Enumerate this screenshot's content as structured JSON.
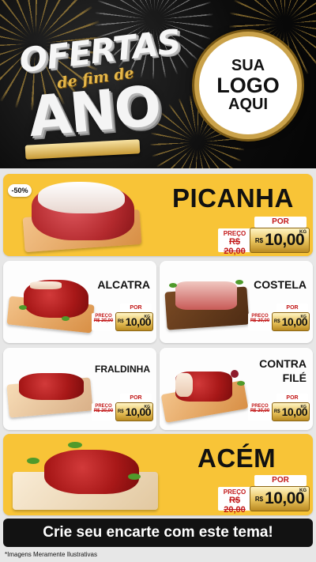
{
  "header": {
    "title_line1": "OFERTAS",
    "title_line2": "de fim de",
    "title_line3": "ANO",
    "logo_line1": "SUA",
    "logo_line2": "LOGO",
    "logo_line3": "AQUI"
  },
  "products": [
    {
      "name": "PICANHA",
      "badge": "-50%",
      "por_label": "POR",
      "preco_label": "PREÇO",
      "old_price": "R$ 20,00",
      "currency": "R$",
      "new_price": "10,00",
      "unit": "KG"
    },
    {
      "name": "ALCATRA",
      "por_label": "POR",
      "preco_label": "PREÇO",
      "old_price": "R$ 20,00",
      "currency": "R$",
      "new_price": "10,00",
      "unit": "KG"
    },
    {
      "name": "COSTELA",
      "por_label": "POR",
      "preco_label": "PREÇO",
      "old_price": "R$ 20,00",
      "currency": "R$",
      "new_price": "10,00",
      "unit": "KG"
    },
    {
      "name": "FRALDINHA",
      "por_label": "POR",
      "preco_label": "PREÇO",
      "old_price": "R$ 20,00",
      "currency": "R$",
      "new_price": "10,00",
      "unit": "KG"
    },
    {
      "name_line1": "CONTRA",
      "name_line2": "FILÉ",
      "por_label": "POR",
      "preco_label": "PREÇO",
      "old_price": "R$ 20,00",
      "currency": "R$",
      "new_price": "10,00",
      "unit": "KG"
    },
    {
      "name": "ACÉM",
      "por_label": "POR",
      "preco_label": "PREÇO",
      "old_price": "R$ 20,00",
      "currency": "R$",
      "new_price": "10,00",
      "unit": "KG"
    }
  ],
  "footer": {
    "cta": "Crie seu encarte com este tema!",
    "disclaimer": "*Imagens Meramente Ilustrativas"
  },
  "colors": {
    "yellow": "#f8c437",
    "gold": "#caa24a",
    "red_text": "#c21717",
    "dark": "#121212"
  }
}
